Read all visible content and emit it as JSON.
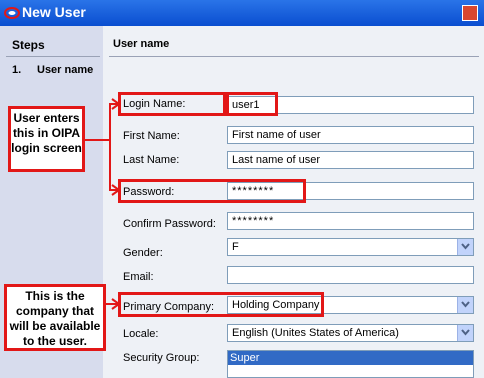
{
  "window": {
    "title": "New User"
  },
  "steps": {
    "header": "Steps",
    "items": [
      {
        "num": "1.",
        "label": "User name"
      }
    ]
  },
  "main": {
    "header": "User name"
  },
  "form": {
    "login_name": {
      "label": "Login Name:",
      "value": "user1"
    },
    "first_name": {
      "label": "First Name:",
      "value": "First name of user"
    },
    "last_name": {
      "label": "Last Name:",
      "value": "Last name of user"
    },
    "password": {
      "label": "Password:",
      "value": "********"
    },
    "confirm_password": {
      "label": "Confirm Password:",
      "value": "********"
    },
    "gender": {
      "label": "Gender:",
      "value": "F"
    },
    "email": {
      "label": "Email:",
      "value": ""
    },
    "primary_company": {
      "label": "Primary Company:",
      "value": "Holding Company"
    },
    "locale": {
      "label": "Locale:",
      "value": "English (Unites States of America)"
    },
    "security_group": {
      "label": "Security Group:",
      "options": [
        "Super"
      ]
    }
  },
  "annotations": {
    "note1_line1": "User enters",
    "note1_line2": "this in OIPA",
    "note1_line3": "login screen",
    "note2_line1": "This is the",
    "note2_line2": "company that",
    "note2_line3": "will be available",
    "note2_line4": "to the user."
  },
  "colors": {
    "callout": "#e21717",
    "titlebar": "#0a4ed0",
    "selection": "#316ac5"
  }
}
